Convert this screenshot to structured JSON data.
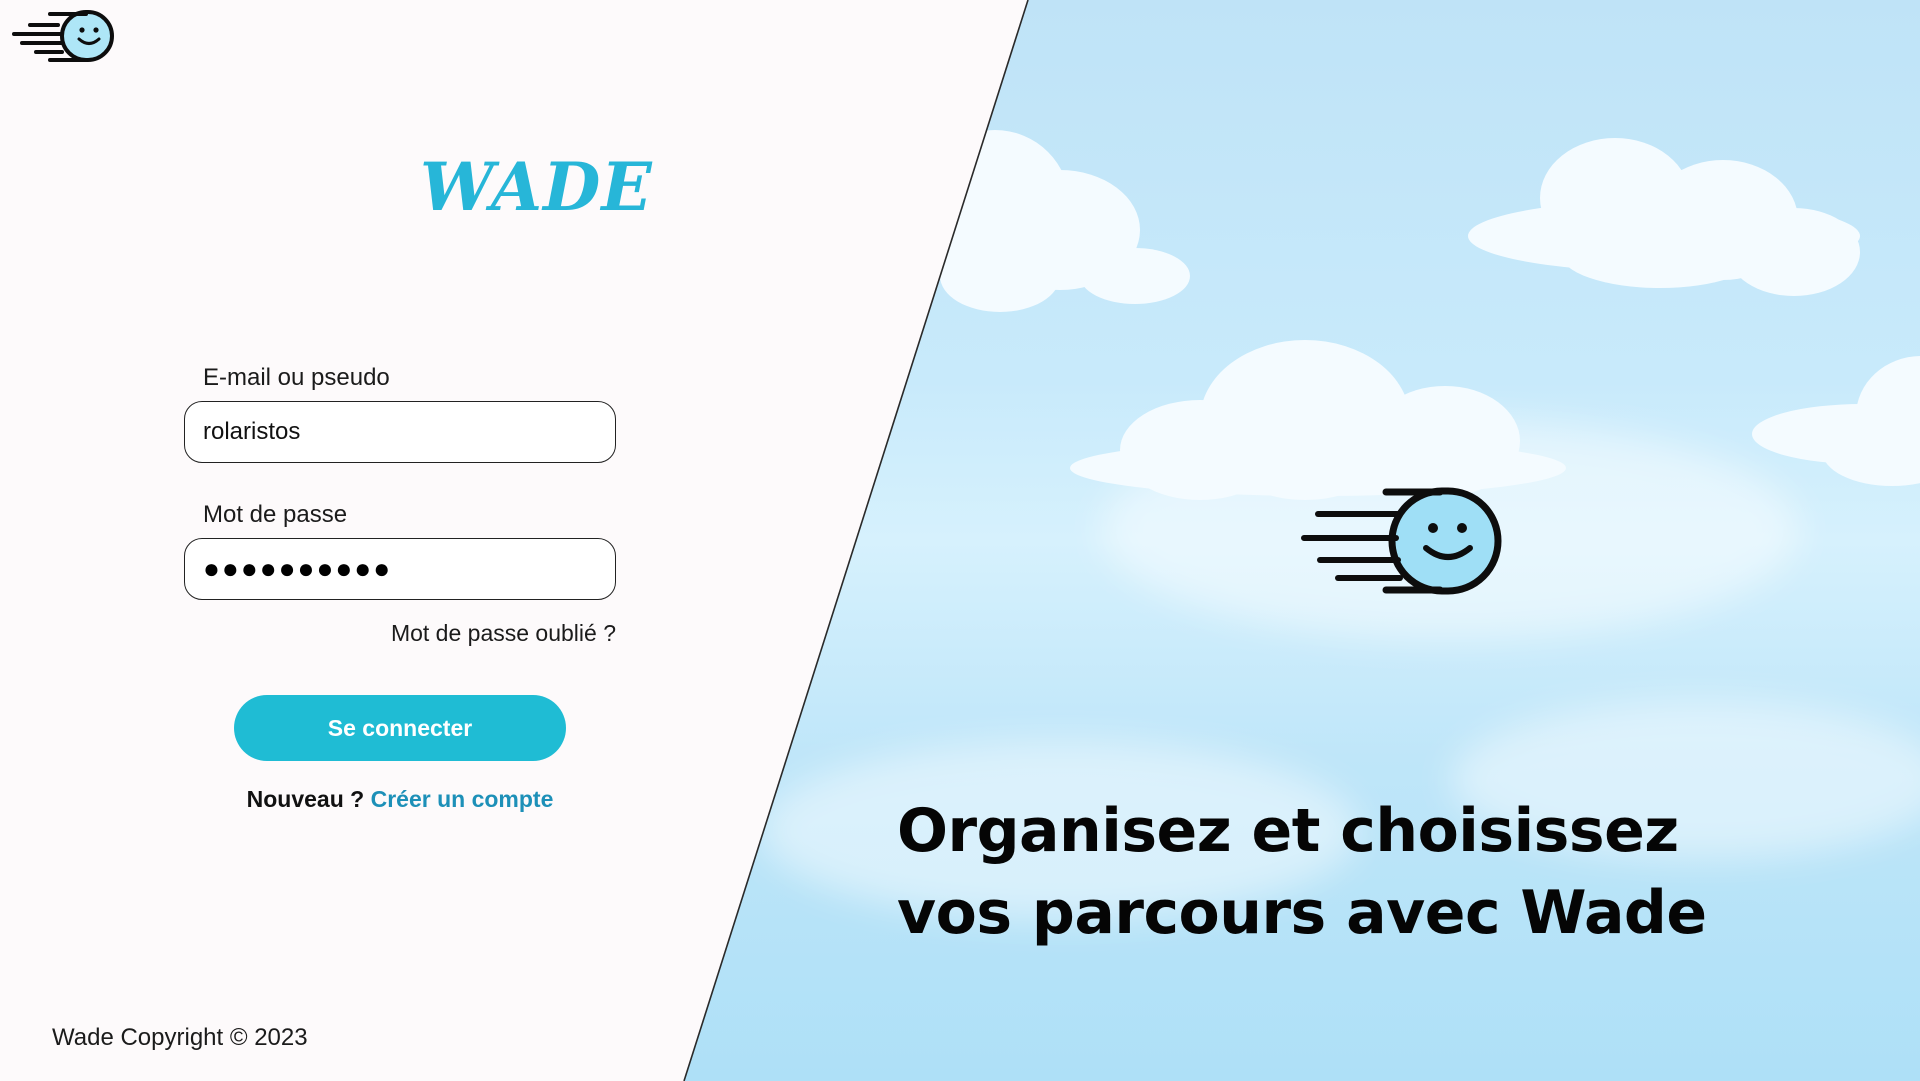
{
  "brand": {
    "name": "WADE",
    "accent_color": "#27b6d8",
    "logo_icon": "flying-smiley-icon"
  },
  "login_form": {
    "identifier_label": "E-mail ou pseudo",
    "identifier_value": "rolaristos",
    "password_label": "Mot de passe",
    "password_masked": "●●●●●●●●●●",
    "forgot_password": "Mot de passe oublié ?",
    "submit_label": "Se connecter",
    "submit_color": "#1fbcd4",
    "new_user_prompt": "Nouveau ?",
    "create_account": "Créer un compte"
  },
  "footer": {
    "copyright": "Wade Copyright © 2023"
  },
  "hero": {
    "tagline_line1": "Organisez et choisissez",
    "tagline_line2": "vos parcours avec Wade",
    "logo_icon": "flying-smiley-icon"
  }
}
